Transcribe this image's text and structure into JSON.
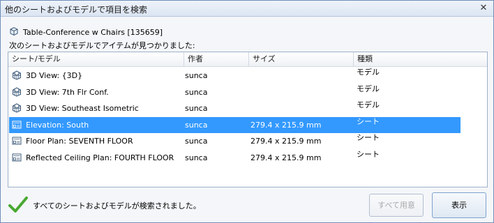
{
  "window": {
    "title": "他のシートおよびモデルで項目を検索",
    "close_label": "✕"
  },
  "element": {
    "name": "Table-Conference w Chairs [135659]",
    "icon": "family-cube-icon"
  },
  "found_label": "次のシートおよびモデルでアイテムが見つかりました:",
  "columns": {
    "sheet_model": "シート/モデル",
    "author": "作者",
    "size": "サイズ",
    "type": "種類"
  },
  "rows": [
    {
      "name": "3D View: {3D}",
      "author": "sunca",
      "size": "",
      "type": "モデル",
      "icon": "3d-view-icon",
      "selected": false
    },
    {
      "name": "3D View: 7th Flr Conf.",
      "author": "sunca",
      "size": "",
      "type": "モデル",
      "icon": "3d-view-icon",
      "selected": false
    },
    {
      "name": "3D View: Southeast Isometric",
      "author": "sunca",
      "size": "",
      "type": "モデル",
      "icon": "3d-view-icon",
      "selected": false
    },
    {
      "name": "Elevation: South",
      "author": "sunca",
      "size": "279.4 x 215.9 mm",
      "type": "シート",
      "icon": "sheet-icon",
      "selected": true
    },
    {
      "name": "Floor Plan: SEVENTH FLOOR",
      "author": "sunca",
      "size": "279.4 x 215.9 mm",
      "type": "シート",
      "icon": "sheet-icon",
      "selected": false
    },
    {
      "name": "Reflected Ceiling Plan: FOURTH FLOOR",
      "author": "sunca",
      "size": "279.4 x 215.9 mm",
      "type": "シート",
      "icon": "sheet-icon",
      "selected": false
    }
  ],
  "status": {
    "text": "すべてのシートおよびモデルが検索されました。",
    "icon": "check-icon",
    "color": "#4aa832"
  },
  "buttons": {
    "all_ready": "すべて用意",
    "show": "表示"
  },
  "colors": {
    "selection": "#3399ff"
  }
}
